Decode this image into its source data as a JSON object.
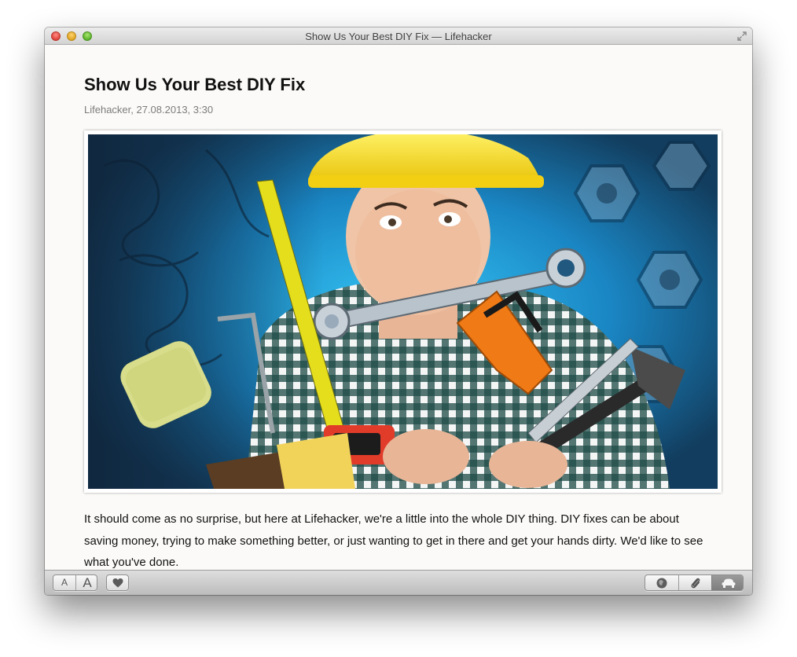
{
  "window": {
    "title": "Show Us Your Best DIY Fix — Lifehacker"
  },
  "article": {
    "title": "Show Us Your Best DIY Fix",
    "meta": "Lifehacker, 27.08.2013, 3:30",
    "body": "It should come as no surprise, but here at Lifehacker, we're a little into the whole DIY thing. DIY fixes can be about saving money, trying to make something better, or just wanting to get in there and get your hands dirty. We'd like to see what you've done."
  },
  "toolbar": {
    "font_small_label": "A",
    "font_large_label": "A",
    "icons": [
      "heart-icon",
      "globe-icon",
      "paperclip-icon",
      "reader-icon"
    ]
  },
  "colors": {
    "hardhat": "#f4d71a",
    "background_blue": "#1e6fa6",
    "accent_orange": "#f07a16"
  }
}
